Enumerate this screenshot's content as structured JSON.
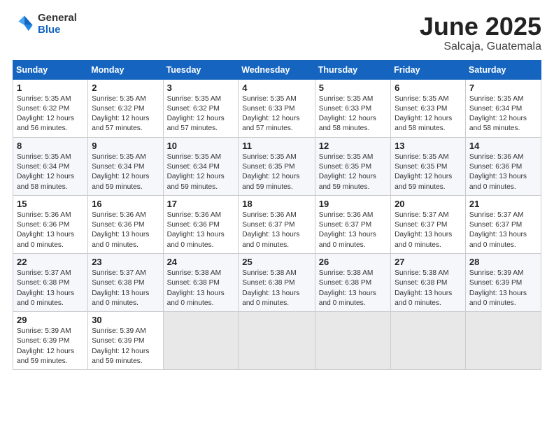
{
  "logo": {
    "general": "General",
    "blue": "Blue"
  },
  "title": {
    "month": "June 2025",
    "location": "Salcaja, Guatemala"
  },
  "header": {
    "days": [
      "Sunday",
      "Monday",
      "Tuesday",
      "Wednesday",
      "Thursday",
      "Friday",
      "Saturday"
    ]
  },
  "weeks": [
    [
      {
        "day": "1",
        "detail": "Sunrise: 5:35 AM\nSunset: 6:32 PM\nDaylight: 12 hours\nand 56 minutes."
      },
      {
        "day": "2",
        "detail": "Sunrise: 5:35 AM\nSunset: 6:32 PM\nDaylight: 12 hours\nand 57 minutes."
      },
      {
        "day": "3",
        "detail": "Sunrise: 5:35 AM\nSunset: 6:32 PM\nDaylight: 12 hours\nand 57 minutes."
      },
      {
        "day": "4",
        "detail": "Sunrise: 5:35 AM\nSunset: 6:33 PM\nDaylight: 12 hours\nand 57 minutes."
      },
      {
        "day": "5",
        "detail": "Sunrise: 5:35 AM\nSunset: 6:33 PM\nDaylight: 12 hours\nand 58 minutes."
      },
      {
        "day": "6",
        "detail": "Sunrise: 5:35 AM\nSunset: 6:33 PM\nDaylight: 12 hours\nand 58 minutes."
      },
      {
        "day": "7",
        "detail": "Sunrise: 5:35 AM\nSunset: 6:34 PM\nDaylight: 12 hours\nand 58 minutes."
      }
    ],
    [
      {
        "day": "8",
        "detail": "Sunrise: 5:35 AM\nSunset: 6:34 PM\nDaylight: 12 hours\nand 58 minutes."
      },
      {
        "day": "9",
        "detail": "Sunrise: 5:35 AM\nSunset: 6:34 PM\nDaylight: 12 hours\nand 59 minutes."
      },
      {
        "day": "10",
        "detail": "Sunrise: 5:35 AM\nSunset: 6:34 PM\nDaylight: 12 hours\nand 59 minutes."
      },
      {
        "day": "11",
        "detail": "Sunrise: 5:35 AM\nSunset: 6:35 PM\nDaylight: 12 hours\nand 59 minutes."
      },
      {
        "day": "12",
        "detail": "Sunrise: 5:35 AM\nSunset: 6:35 PM\nDaylight: 12 hours\nand 59 minutes."
      },
      {
        "day": "13",
        "detail": "Sunrise: 5:35 AM\nSunset: 6:35 PM\nDaylight: 12 hours\nand 59 minutes."
      },
      {
        "day": "14",
        "detail": "Sunrise: 5:36 AM\nSunset: 6:36 PM\nDaylight: 13 hours\nand 0 minutes."
      }
    ],
    [
      {
        "day": "15",
        "detail": "Sunrise: 5:36 AM\nSunset: 6:36 PM\nDaylight: 13 hours\nand 0 minutes."
      },
      {
        "day": "16",
        "detail": "Sunrise: 5:36 AM\nSunset: 6:36 PM\nDaylight: 13 hours\nand 0 minutes."
      },
      {
        "day": "17",
        "detail": "Sunrise: 5:36 AM\nSunset: 6:36 PM\nDaylight: 13 hours\nand 0 minutes."
      },
      {
        "day": "18",
        "detail": "Sunrise: 5:36 AM\nSunset: 6:37 PM\nDaylight: 13 hours\nand 0 minutes."
      },
      {
        "day": "19",
        "detail": "Sunrise: 5:36 AM\nSunset: 6:37 PM\nDaylight: 13 hours\nand 0 minutes."
      },
      {
        "day": "20",
        "detail": "Sunrise: 5:37 AM\nSunset: 6:37 PM\nDaylight: 13 hours\nand 0 minutes."
      },
      {
        "day": "21",
        "detail": "Sunrise: 5:37 AM\nSunset: 6:37 PM\nDaylight: 13 hours\nand 0 minutes."
      }
    ],
    [
      {
        "day": "22",
        "detail": "Sunrise: 5:37 AM\nSunset: 6:38 PM\nDaylight: 13 hours\nand 0 minutes."
      },
      {
        "day": "23",
        "detail": "Sunrise: 5:37 AM\nSunset: 6:38 PM\nDaylight: 13 hours\nand 0 minutes."
      },
      {
        "day": "24",
        "detail": "Sunrise: 5:38 AM\nSunset: 6:38 PM\nDaylight: 13 hours\nand 0 minutes."
      },
      {
        "day": "25",
        "detail": "Sunrise: 5:38 AM\nSunset: 6:38 PM\nDaylight: 13 hours\nand 0 minutes."
      },
      {
        "day": "26",
        "detail": "Sunrise: 5:38 AM\nSunset: 6:38 PM\nDaylight: 13 hours\nand 0 minutes."
      },
      {
        "day": "27",
        "detail": "Sunrise: 5:38 AM\nSunset: 6:38 PM\nDaylight: 13 hours\nand 0 minutes."
      },
      {
        "day": "28",
        "detail": "Sunrise: 5:39 AM\nSunset: 6:39 PM\nDaylight: 13 hours\nand 0 minutes."
      }
    ],
    [
      {
        "day": "29",
        "detail": "Sunrise: 5:39 AM\nSunset: 6:39 PM\nDaylight: 12 hours\nand 59 minutes."
      },
      {
        "day": "30",
        "detail": "Sunrise: 5:39 AM\nSunset: 6:39 PM\nDaylight: 12 hours\nand 59 minutes."
      },
      {
        "day": "",
        "detail": ""
      },
      {
        "day": "",
        "detail": ""
      },
      {
        "day": "",
        "detail": ""
      },
      {
        "day": "",
        "detail": ""
      },
      {
        "day": "",
        "detail": ""
      }
    ]
  ]
}
